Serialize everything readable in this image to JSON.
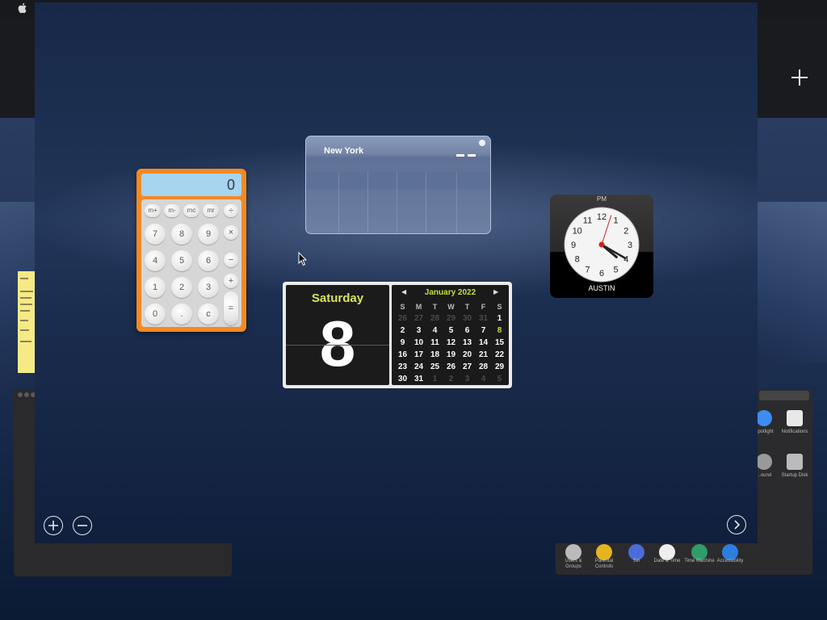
{
  "desktop": {
    "top_plus_label": "+",
    "note_lines": [
      "Make",
      "Sticki",
      "a Sti",
      "inform",
      "tool d",
      "• To d",
      "• To ",
      "Your"
    ],
    "prefs": [
      {
        "label": "Spotlight"
      },
      {
        "label": "Notifications"
      },
      {
        "label": "...ound"
      },
      {
        "label": "Startup Disk"
      },
      {
        "label": "Users & Groups"
      },
      {
        "label": "Parental Controls"
      },
      {
        "label": "Siri"
      },
      {
        "label": "Date & Time"
      },
      {
        "label": "Time Machine"
      },
      {
        "label": "Accessibility"
      }
    ]
  },
  "dashboard": {
    "add_widget_icon": "plus-circle-icon",
    "remove_widget_icon": "minus-circle-icon",
    "next_page_icon": "chevron-right-circle-icon"
  },
  "calculator": {
    "display": "0",
    "memory_keys": [
      "m+",
      "m-",
      "mc",
      "mr",
      "÷"
    ],
    "rows": [
      [
        "7",
        "8",
        "9",
        "×"
      ],
      [
        "4",
        "5",
        "6",
        "−"
      ],
      [
        "1",
        "2",
        "3",
        "+"
      ],
      [
        "0",
        ".",
        "c",
        "="
      ]
    ]
  },
  "world_clock": {
    "city": "New York",
    "time_display": "– –"
  },
  "calendar": {
    "weekday": "Saturday",
    "day": "8",
    "month_label": "January 2022",
    "prev_icon": "triangle-left-icon",
    "next_icon": "triangle-right-icon",
    "headers": [
      "S",
      "M",
      "T",
      "W",
      "T",
      "F",
      "S"
    ],
    "weeks": [
      [
        "26",
        "27",
        "28",
        "29",
        "30",
        "31",
        "1"
      ],
      [
        "2",
        "3",
        "4",
        "5",
        "6",
        "7",
        "8"
      ],
      [
        "9",
        "10",
        "11",
        "12",
        "13",
        "14",
        "15"
      ],
      [
        "16",
        "17",
        "18",
        "19",
        "20",
        "21",
        "22"
      ],
      [
        "23",
        "24",
        "25",
        "26",
        "27",
        "28",
        "29"
      ],
      [
        "30",
        "31",
        "1",
        "2",
        "3",
        "4",
        "5"
      ]
    ]
  },
  "analog_clock": {
    "period": "PM",
    "city": "AUSTIN",
    "numerals": [
      "12",
      "1",
      "2",
      "3",
      "4",
      "5",
      "6",
      "7",
      "8",
      "9",
      "10",
      "11"
    ],
    "hour": 4,
    "minute": 20,
    "second": 3
  },
  "colors": {
    "calc_orange": "#f28a24",
    "calendar_accent": "#c7dc3c",
    "second_hand": "#d22020"
  }
}
